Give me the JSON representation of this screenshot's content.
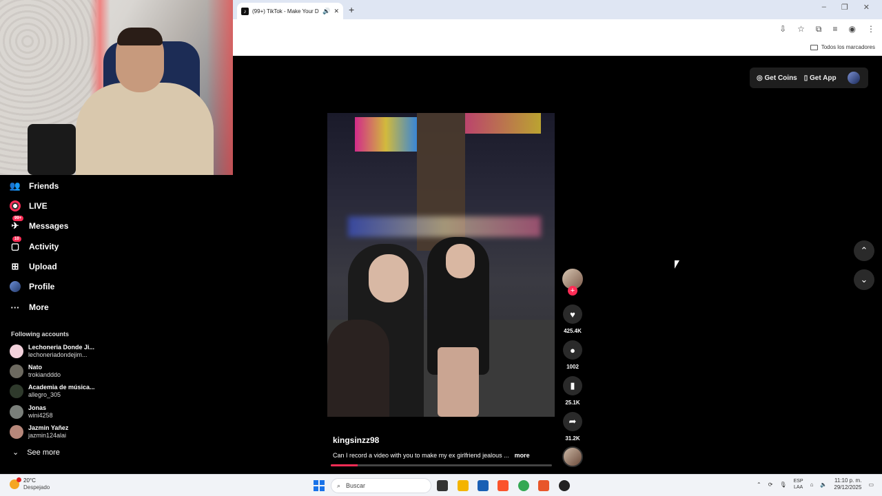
{
  "browser": {
    "tab_title": "(99+) TikTok - Make Your D",
    "new_tab": "+",
    "bookmarks_label": "Todos los marcadores"
  },
  "sidebar": {
    "items": [
      {
        "label": "Friends",
        "icon": "friends-icon"
      },
      {
        "label": "LIVE",
        "icon": "live-icon"
      },
      {
        "label": "Messages",
        "icon": "messages-icon",
        "badge": "99+"
      },
      {
        "label": "Activity",
        "icon": "activity-icon",
        "badge": "10"
      },
      {
        "label": "Upload",
        "icon": "upload-icon"
      },
      {
        "label": "Profile",
        "icon": "profile-icon"
      },
      {
        "label": "More",
        "icon": "more-icon"
      }
    ],
    "following_title": "Following accounts",
    "following": [
      {
        "name": "Lechoneria Donde Ji...",
        "handle": "lechoneriadondejim..."
      },
      {
        "name": "Nato",
        "handle": "trokiandddo"
      },
      {
        "name": "Academia de música...",
        "handle": "allegro_305"
      },
      {
        "name": "Jonas",
        "handle": "wini4258"
      },
      {
        "name": "Jazmin Yañez",
        "handle": "jazmin124alai"
      }
    ],
    "see_more": "See more"
  },
  "top_actions": {
    "get_coins": "Get Coins",
    "get_app": "Get App"
  },
  "video": {
    "username": "kingsinzz98",
    "caption": "Can I record a video with you to make my ex girlfriend jealous ...",
    "more": "more",
    "progress": 0.12
  },
  "rail": {
    "likes": "425.4K",
    "comments": "1002",
    "saves": "25.1K",
    "shares": "31.2K"
  },
  "taskbar": {
    "temp": "20°C",
    "weather": "Despejado",
    "search_placeholder": "Buscar",
    "lang1": "ESP",
    "lang2": "LAA",
    "time": "11:10 p. m.",
    "date": "29/12/2025"
  }
}
